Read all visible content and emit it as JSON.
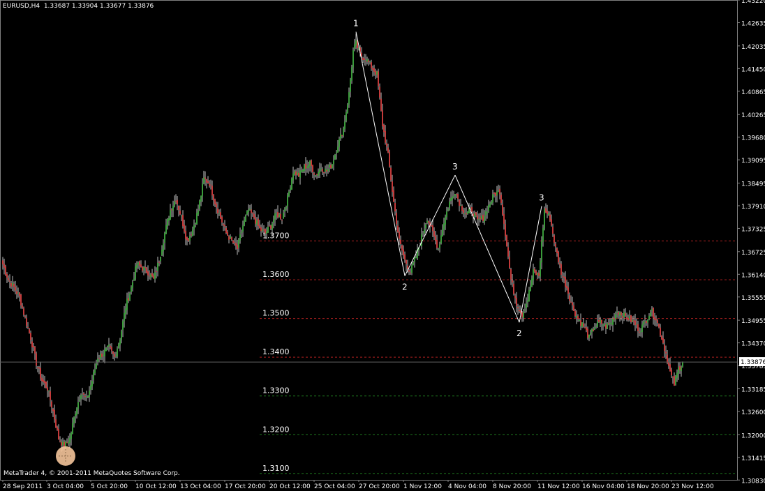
{
  "header": {
    "symbol_line": "EURUSD,H4  1.33687 1.33904 1.33677 1.33876"
  },
  "footer": {
    "copyright": "MetaTrader 4, © 2001-2011 MetaQuotes Software Corp."
  },
  "colors": {
    "background": "#000000",
    "frame": "#808080",
    "bull_candle": "#3a9a3a",
    "bear_candle": "#c43a3a",
    "wick": "#bfbfbf",
    "wave_line": "#ffffff",
    "red_level": "#b32020",
    "green_level": "#1f7a1f",
    "text": "#ffffff",
    "marker": "#f4c49a"
  },
  "chart_data": {
    "type": "candlestick",
    "ylim": [
      1.30835,
      1.4322
    ],
    "y_ticks": [
      "1.43220",
      "1.42635",
      "1.42035",
      "1.41450",
      "1.40865",
      "1.40265",
      "1.39680",
      "1.39095",
      "1.38495",
      "1.37910",
      "1.37325",
      "1.36725",
      "1.36140",
      "1.35555",
      "1.34955",
      "1.34370",
      "1.33785",
      "1.33185",
      "1.32600",
      "1.32000",
      "1.31415",
      "1.30830"
    ],
    "x_ticks": [
      "28 Sep 2011",
      "3 Oct 04:00",
      "5 Oct 20:00",
      "10 Oct 12:00",
      "13 Oct 04:00",
      "17 Oct 20:00",
      "20 Oct 12:00",
      "25 Oct 04:00",
      "27 Oct 20:00",
      "1 Nov 12:00",
      "4 Nov 04:00",
      "8 Nov 20:00",
      "11 Nov 12:00",
      "16 Nov 04:00",
      "18 Nov 20:00",
      "23 Nov 12:00"
    ],
    "current_price": "1.33876",
    "close_path": [
      [
        0,
        1.364
      ],
      [
        4,
        1.36
      ],
      [
        8,
        1.358
      ],
      [
        12,
        1.3555
      ],
      [
        16,
        1.35
      ],
      [
        20,
        1.345
      ],
      [
        24,
        1.3385
      ],
      [
        28,
        1.334
      ],
      [
        32,
        1.332
      ],
      [
        36,
        1.326
      ],
      [
        40,
        1.319
      ],
      [
        44,
        1.317
      ],
      [
        48,
        1.319
      ],
      [
        52,
        1.326
      ],
      [
        56,
        1.331
      ],
      [
        60,
        1.329
      ],
      [
        64,
        1.334
      ],
      [
        68,
        1.34
      ],
      [
        72,
        1.341
      ],
      [
        76,
        1.3425
      ],
      [
        80,
        1.34
      ],
      [
        84,
        1.345
      ],
      [
        88,
        1.353
      ],
      [
        92,
        1.358
      ],
      [
        96,
        1.364
      ],
      [
        100,
        1.363
      ],
      [
        104,
        1.362
      ],
      [
        108,
        1.36
      ],
      [
        112,
        1.365
      ],
      [
        116,
        1.372
      ],
      [
        120,
        1.378
      ],
      [
        124,
        1.381
      ],
      [
        128,
        1.376
      ],
      [
        132,
        1.37
      ],
      [
        136,
        1.373
      ],
      [
        140,
        1.378
      ],
      [
        144,
        1.386
      ],
      [
        148,
        1.385
      ],
      [
        152,
        1.38
      ],
      [
        156,
        1.376
      ],
      [
        160,
        1.372
      ],
      [
        164,
        1.37
      ],
      [
        168,
        1.368
      ],
      [
        172,
        1.374
      ],
      [
        176,
        1.378
      ],
      [
        180,
        1.376
      ],
      [
        184,
        1.373
      ],
      [
        188,
        1.372
      ],
      [
        192,
        1.374
      ],
      [
        196,
        1.377
      ],
      [
        200,
        1.376
      ],
      [
        204,
        1.381
      ],
      [
        208,
        1.388
      ],
      [
        212,
        1.387
      ],
      [
        216,
        1.389
      ],
      [
        220,
        1.39
      ],
      [
        224,
        1.387
      ],
      [
        228,
        1.389
      ],
      [
        232,
        1.388
      ],
      [
        236,
        1.39
      ],
      [
        240,
        1.395
      ],
      [
        244,
        1.399
      ],
      [
        248,
        1.408
      ],
      [
        251,
        1.419
      ],
      [
        253,
        1.421
      ],
      [
        256,
        1.418
      ],
      [
        260,
        1.417
      ],
      [
        264,
        1.415
      ],
      [
        268,
        1.413
      ],
      [
        272,
        1.4
      ],
      [
        276,
        1.392
      ],
      [
        280,
        1.38
      ],
      [
        284,
        1.37
      ],
      [
        288,
        1.365
      ],
      [
        292,
        1.362
      ],
      [
        296,
        1.366
      ],
      [
        300,
        1.371
      ],
      [
        304,
        1.376
      ],
      [
        308,
        1.372
      ],
      [
        312,
        1.368
      ],
      [
        316,
        1.375
      ],
      [
        320,
        1.38
      ],
      [
        324,
        1.383
      ],
      [
        328,
        1.379
      ],
      [
        332,
        1.377
      ],
      [
        336,
        1.378
      ],
      [
        340,
        1.375
      ],
      [
        344,
        1.376
      ],
      [
        348,
        1.379
      ],
      [
        352,
        1.382
      ],
      [
        356,
        1.383
      ],
      [
        360,
        1.372
      ],
      [
        364,
        1.36
      ],
      [
        368,
        1.354
      ],
      [
        372,
        1.351
      ],
      [
        376,
        1.355
      ],
      [
        380,
        1.362
      ],
      [
        384,
        1.361
      ],
      [
        388,
        1.378
      ],
      [
        392,
        1.376
      ],
      [
        396,
        1.368
      ],
      [
        400,
        1.362
      ],
      [
        404,
        1.358
      ],
      [
        408,
        1.353
      ],
      [
        412,
        1.35
      ],
      [
        416,
        1.348
      ],
      [
        420,
        1.345
      ],
      [
        424,
        1.348
      ],
      [
        428,
        1.349
      ],
      [
        432,
        1.348
      ],
      [
        436,
        1.349
      ],
      [
        440,
        1.352
      ],
      [
        444,
        1.351
      ],
      [
        448,
        1.35
      ],
      [
        452,
        1.349
      ],
      [
        456,
        1.347
      ],
      [
        460,
        1.349
      ],
      [
        464,
        1.352
      ],
      [
        468,
        1.35
      ],
      [
        472,
        1.345
      ],
      [
        475,
        1.341
      ],
      [
        478,
        1.336
      ],
      [
        481,
        1.333
      ],
      [
        484,
        1.337
      ],
      [
        487,
        1.3388
      ]
    ],
    "horizontal_levels": [
      {
        "price": 1.37,
        "label": "1.3700",
        "kind": "red"
      },
      {
        "price": 1.36,
        "label": "1.3600",
        "kind": "red"
      },
      {
        "price": 1.35,
        "label": "1.3500",
        "kind": "red"
      },
      {
        "price": 1.34,
        "label": "1.3400",
        "kind": "red"
      },
      {
        "price": 1.33,
        "label": "1.3300",
        "kind": "green"
      },
      {
        "price": 1.32,
        "label": "1.3200",
        "kind": "green"
      },
      {
        "price": 1.31,
        "label": "1.3100",
        "kind": "green"
      }
    ],
    "wave_points": [
      {
        "bar": 253,
        "price": 1.424,
        "label": "1"
      },
      {
        "bar": 288,
        "price": 1.361,
        "label": "2"
      },
      {
        "bar": 324,
        "price": 1.387,
        "label": "3"
      },
      {
        "bar": 370,
        "price": 1.349,
        "label": "2"
      },
      {
        "bar": 386,
        "price": 1.379,
        "label": "3"
      }
    ]
  }
}
